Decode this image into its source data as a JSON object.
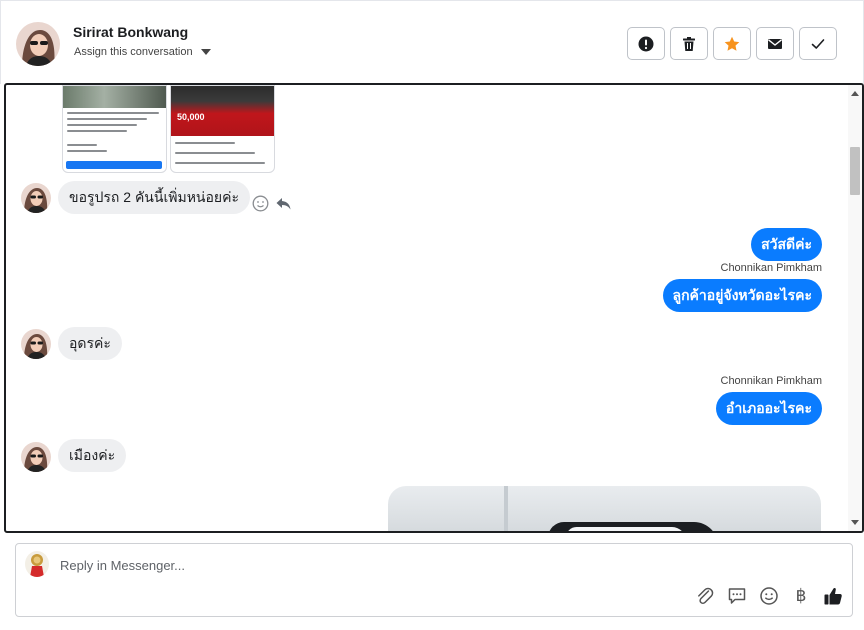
{
  "header": {
    "contact_name": "Sirirat Bonkwang",
    "assign_label": "Assign this conversation",
    "actions": [
      {
        "name": "spam-button",
        "icon": "exclamation-circle-icon"
      },
      {
        "name": "delete-button",
        "icon": "trash-icon"
      },
      {
        "name": "star-button",
        "icon": "star-icon",
        "color": "#f7931e"
      },
      {
        "name": "mark-unread-button",
        "icon": "envelope-icon"
      },
      {
        "name": "mark-done-button",
        "icon": "check-icon"
      }
    ]
  },
  "thread": {
    "attachment_preview": {
      "price_text": "50,000"
    },
    "messages": [
      {
        "direction": "in",
        "text": "ขอรูปรถ 2 คันนี้เพิ่มหน่อยค่ะ"
      },
      {
        "direction": "out",
        "text": "สวัสดีค่ะ"
      },
      {
        "direction": "out",
        "sender": "Chonnikan Pimkham",
        "text": "ลูกค้าอยู่จังหวัดอะไรคะ"
      },
      {
        "direction": "in",
        "text": "อุดรค่ะ"
      },
      {
        "direction": "out",
        "sender": "Chonnikan Pimkham",
        "text": "อำเภออะไรคะ"
      },
      {
        "direction": "in",
        "text": "เมืองค่ะ"
      }
    ]
  },
  "composer": {
    "placeholder": "Reply in Messenger...",
    "tools": [
      "paperclip-icon",
      "saved-reply-icon",
      "emoji-icon",
      "baht-icon",
      "thumbs-up-icon"
    ],
    "baht_symbol": "฿"
  },
  "colors": {
    "outgoing_bubble": "#0a7cff",
    "incoming_bubble": "#eeeff1",
    "star": "#f7931e"
  }
}
